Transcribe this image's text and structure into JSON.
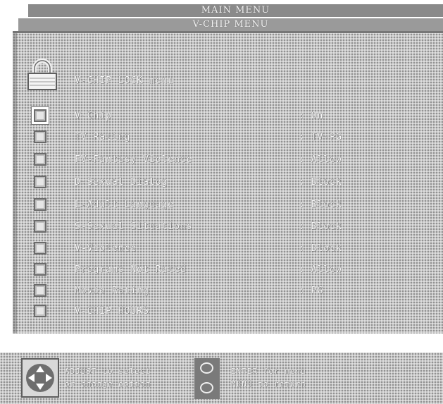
{
  "header": {
    "main_menu_title": "MAIN MENU",
    "submenu_title": "V-CHIP MENU"
  },
  "lock_menu_label": "V-CHIP LOCK menu",
  "items": [
    {
      "label": "V-Chip",
      "value": ": On",
      "selected": true
    },
    {
      "label": "TV Rating",
      "value": ": TV-PG"
    },
    {
      "label": "FV-Fantasy Violence",
      "value": ": Allow"
    },
    {
      "label": "D-Sexual Dialog",
      "value": ": Block"
    },
    {
      "label": "L-Adult Language",
      "value": ": Block"
    },
    {
      "label": "S-Sexual Situations",
      "value": ": Block"
    },
    {
      "label": "V-Violence",
      "value": ": Block"
    },
    {
      "label": "Programs Not Rated",
      "value": ": Allow"
    },
    {
      "label": "Movie Rating",
      "value": ": PG"
    },
    {
      "label": "V-CHIP HOURS",
      "value": ""
    }
  ],
  "footer": {
    "adjust_line1": "ADJUST to select",
    "adjust_line2": "or change option",
    "enter_line": "ENTER for menu",
    "menu_line": "MENU to return"
  },
  "icons": {
    "lock": "padlock-icon",
    "dpad": "directional-pad-icon",
    "buttons": "enter-menu-buttons-icon"
  }
}
